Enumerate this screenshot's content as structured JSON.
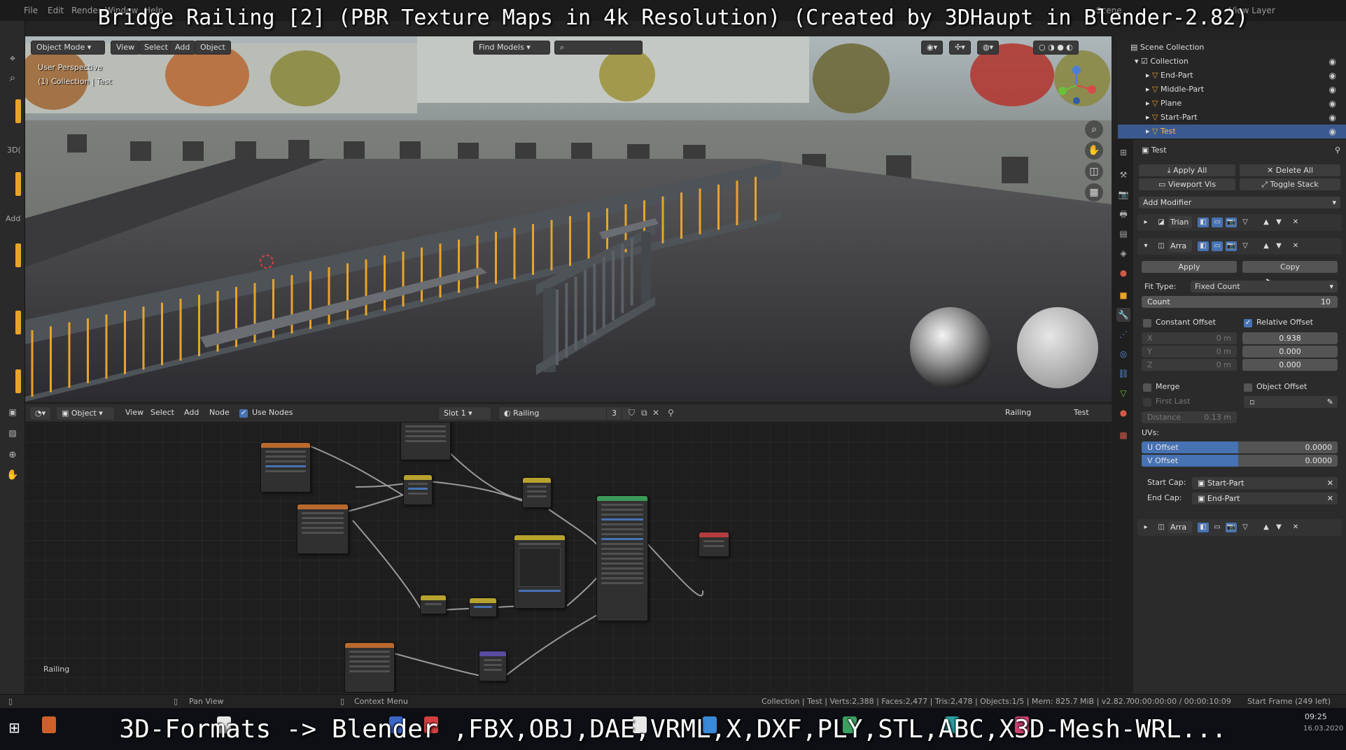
{
  "overlay": {
    "title": "Bridge Railing [2] (PBR Texture Maps in 4k Resolution) (Created by 3DHaupt in Blender-2.82)",
    "bottom": "3D-Formats -> Blender ,FBX,OBJ,DAE,VRML,X,DXF,PLY,STL,ABC,X3D-Mesh-WRL..."
  },
  "topbar": {
    "menus": [
      "File",
      "Edit",
      "Render",
      "Window",
      "Help"
    ],
    "scene": "Scene",
    "view_layer": "View Layer"
  },
  "left_toolbar": {
    "labels": [
      "3D(",
      "Add"
    ]
  },
  "viewport": {
    "mode": "Object Mode",
    "menus": [
      "View",
      "Select",
      "Add",
      "Object"
    ],
    "find_models": "Find Models",
    "perspective": "User Perspective",
    "collection_info": "(1) Collection | Test"
  },
  "node_editor": {
    "editor_type": "Object",
    "menus": [
      "View",
      "Select",
      "Add",
      "Node"
    ],
    "use_nodes": "Use Nodes",
    "slot": "Slot 1",
    "material": "Railing",
    "user_count": "3",
    "right_material": "Railing",
    "right_object": "Test",
    "frame_label": "Railing"
  },
  "outliner": {
    "scene_collection": "Scene Collection",
    "collection": "Collection",
    "items": [
      "End-Part",
      "Middle-Part",
      "Plane",
      "Start-Part",
      "Test"
    ],
    "selected": "Test"
  },
  "properties": {
    "object_name": "Test",
    "apply_all": "Apply All",
    "delete_all": "Delete All",
    "viewport_vis": "Viewport Vis",
    "toggle_stack": "Toggle Stack",
    "add_modifier": "Add Modifier",
    "mod1_name": "Trian",
    "mod2_name": "Arra",
    "apply": "Apply",
    "copy": "Copy",
    "fit_type_label": "Fit Type:",
    "fit_type_value": "Fixed Count",
    "count_label": "Count",
    "count_value": "10",
    "constant_offset": "Constant Offset",
    "relative_offset": "Relative Offset",
    "x_label": "X",
    "y_label": "Y",
    "z_label": "Z",
    "const_x": "0 m",
    "const_y": "0 m",
    "const_z": "0 m",
    "rel_x": "0.938",
    "rel_y": "0.000",
    "rel_z": "0.000",
    "merge": "Merge",
    "object_offset": "Object Offset",
    "first_last": "First Last",
    "distance_label": "Distance",
    "distance_value": "0.13 m",
    "uvs": "UVs:",
    "u_offset_label": "U Offset",
    "u_offset_value": "0.0000",
    "v_offset_label": "V Offset",
    "v_offset_value": "0.0000",
    "start_cap_label": "Start Cap:",
    "start_cap_value": "Start-Part",
    "end_cap_label": "End Cap:",
    "end_cap_value": "End-Part",
    "mod3_name": "Arra"
  },
  "statusbar": {
    "pan_view": "Pan View",
    "context_menu": "Context Menu",
    "stats": "Collection | Test | Verts:2,388 | Faces:2,477 | Tris:2,478 | Objects:1/5 | Mem: 825.7 MiB | v2.82.7",
    "time": "00:00:00:00 / 00:00:10:09",
    "start_frame": "Start Frame (249 left)"
  },
  "taskbar": {
    "clock": "09:25",
    "date": "16.03.2020"
  },
  "colors": {
    "accent_orange": "#e8a32a",
    "selection_blue": "#4772b3"
  }
}
